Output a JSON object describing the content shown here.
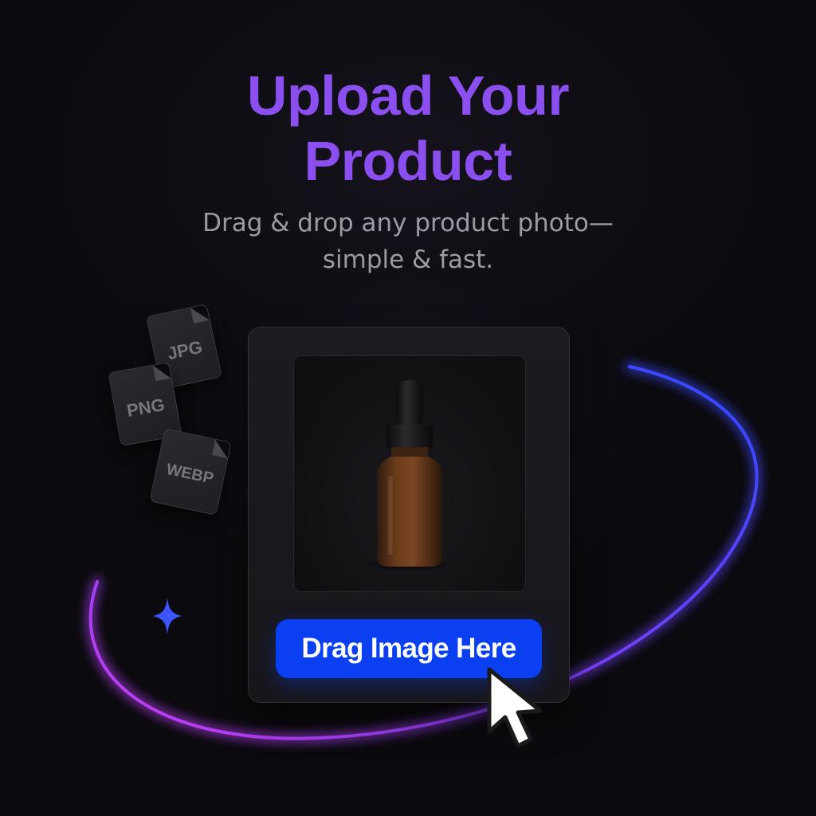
{
  "header": {
    "title_line_1": "Upload Your",
    "title_line_2": "Product",
    "subtitle_line_1": "Drag & drop any product photo—",
    "subtitle_line_2": "simple & fast."
  },
  "file_types": [
    {
      "label": "JPG"
    },
    {
      "label": "PNG"
    },
    {
      "label": "WEBP"
    }
  ],
  "upload_card": {
    "preview_image": "amber dropper bottle product photo",
    "button_label": "Drag Image Here"
  },
  "icons": {
    "cursor": "arrow-cursor-icon",
    "sparkle": "sparkle-icon"
  },
  "colors": {
    "title": "#8a4fee",
    "button": "#0b3ff2",
    "background": "#0b0a0e",
    "ring_start": "#c93cf5",
    "ring_end": "#2f49ff"
  }
}
